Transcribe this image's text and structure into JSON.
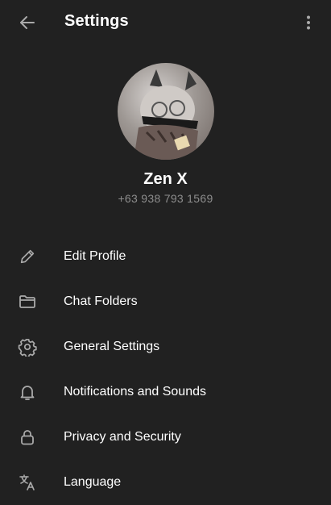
{
  "header": {
    "title": "Settings",
    "back_icon": "arrow-left-icon",
    "more_icon": "more-vertical-icon"
  },
  "profile": {
    "name": "Zen X",
    "phone": "+63 938 793 1569"
  },
  "menu": [
    {
      "label": "Edit Profile",
      "icon": "pencil-icon"
    },
    {
      "label": "Chat Folders",
      "icon": "folder-icon"
    },
    {
      "label": "General Settings",
      "icon": "gear-icon"
    },
    {
      "label": "Notifications and Sounds",
      "icon": "bell-icon"
    },
    {
      "label": "Privacy and Security",
      "icon": "lock-icon"
    },
    {
      "label": "Language",
      "icon": "translate-icon"
    }
  ],
  "colors": {
    "background": "#212121",
    "text": "#ffffff",
    "secondary_text": "#8d8d8d",
    "icon": "#aaaaaa"
  }
}
